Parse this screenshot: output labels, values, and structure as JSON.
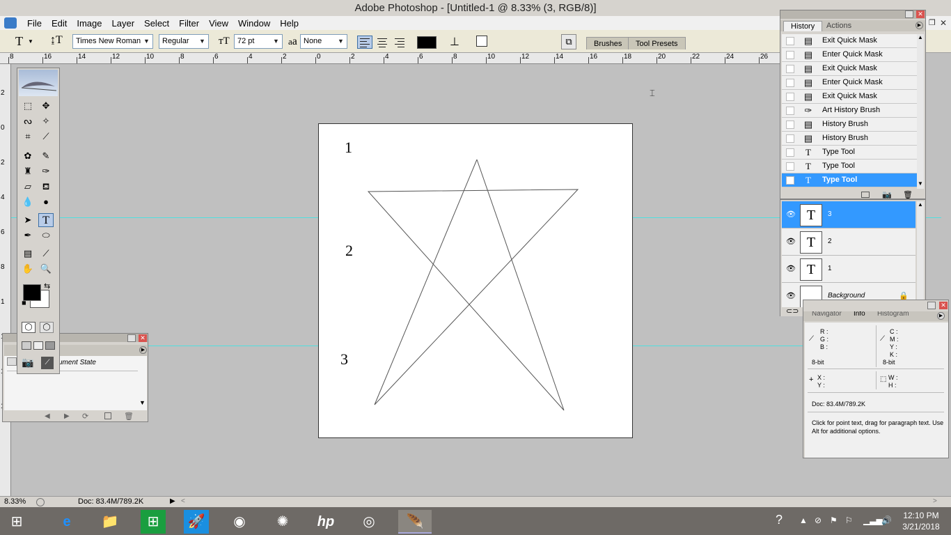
{
  "window": {
    "title": "Adobe Photoshop - [Untitled-1 @ 8.33% (3, RGB/8)]"
  },
  "menu": [
    "File",
    "Edit",
    "Image",
    "Layer",
    "Select",
    "Filter",
    "View",
    "Window",
    "Help"
  ],
  "options": {
    "font_family": "Times New Roman",
    "font_style": "Regular",
    "font_size": "72 pt",
    "antialias_prefix": "a",
    "antialias_sub": "a",
    "antialias": "None",
    "text_color": "#000000",
    "tabs": [
      "Brushes",
      "Tool Presets"
    ]
  },
  "rulers": {
    "h": [
      "8",
      "16",
      "14",
      "12",
      "10",
      "8",
      "6",
      "4",
      "2",
      "0",
      "2",
      "4",
      "6",
      "8",
      "10",
      "12",
      "14",
      "16",
      "18",
      "20",
      "22",
      "24",
      "26"
    ],
    "v": [
      "2",
      "0",
      "2",
      "4",
      "6",
      "8",
      "1",
      "1",
      "1",
      "1"
    ]
  },
  "canvas": {
    "labels": [
      "1",
      "2",
      "3"
    ],
    "background": "#ffffff",
    "guide_color": "#4fe0e0"
  },
  "history": {
    "tabs": [
      "History",
      "Actions"
    ],
    "items": [
      {
        "label": "Exit Quick Mask",
        "icon": "history-state-icon"
      },
      {
        "label": "Enter Quick Mask",
        "icon": "history-state-icon"
      },
      {
        "label": "Exit Quick Mask",
        "icon": "history-state-icon"
      },
      {
        "label": "Enter Quick Mask",
        "icon": "history-state-icon"
      },
      {
        "label": "Exit Quick Mask",
        "icon": "history-state-icon"
      },
      {
        "label": "Art History Brush",
        "icon": "art-history-brush-icon"
      },
      {
        "label": "History Brush",
        "icon": "history-state-icon"
      },
      {
        "label": "History Brush",
        "icon": "history-state-icon"
      },
      {
        "label": "Type Tool",
        "icon": "type-tool-icon"
      },
      {
        "label": "Type Tool",
        "icon": "type-tool-icon"
      },
      {
        "label": "Type Tool",
        "icon": "type-tool-icon",
        "selected": true
      }
    ]
  },
  "layers": {
    "items": [
      {
        "name": "3",
        "thumb": "T",
        "selected": true
      },
      {
        "name": "2",
        "thumb": "T"
      },
      {
        "name": "1",
        "thumb": "T"
      },
      {
        "name": "Background",
        "thumb": "",
        "locked": true
      }
    ]
  },
  "info": {
    "tabs": [
      "Navigator",
      "Info",
      "Histogram"
    ],
    "rgb": [
      "R :",
      "G :",
      "B :"
    ],
    "cmyk": [
      "C :",
      "M :",
      "Y :",
      "K :"
    ],
    "bitdepth": "8-bit",
    "bitdepth2": "8-bit",
    "xy": [
      "X :",
      "Y :"
    ],
    "wh": [
      "W :",
      "H :"
    ],
    "doc": "Doc: 83.4M/789.2K",
    "hint": "Click for point text, drag for paragraph text. Use Alt for additional options."
  },
  "small_history": {
    "state_label": "ument State"
  },
  "status": {
    "zoom": "8.33%",
    "doc": "Doc: 83.4M/789.2K"
  },
  "taskbar": {
    "time": "12:10 PM",
    "date": "3/21/2018"
  }
}
